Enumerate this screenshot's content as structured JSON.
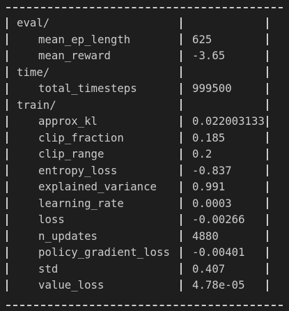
{
  "sections": [
    {
      "header": "eval/",
      "rows": [
        {
          "key": "mean_ep_length",
          "value": "625"
        },
        {
          "key": "mean_reward",
          "value": "-3.65"
        }
      ]
    },
    {
      "header": "time/",
      "rows": [
        {
          "key": "total_timesteps",
          "value": "999500"
        }
      ]
    },
    {
      "header": "train/",
      "rows": [
        {
          "key": "approx_kl",
          "value": "0.022003133"
        },
        {
          "key": "clip_fraction",
          "value": "0.185"
        },
        {
          "key": "clip_range",
          "value": "0.2"
        },
        {
          "key": "entropy_loss",
          "value": "-0.837"
        },
        {
          "key": "explained_variance",
          "value": "0.991"
        },
        {
          "key": "learning_rate",
          "value": "0.0003"
        },
        {
          "key": "loss",
          "value": "-0.00266"
        },
        {
          "key": "n_updates",
          "value": "4880"
        },
        {
          "key": "policy_gradient_loss",
          "value": "-0.00401"
        },
        {
          "key": "std",
          "value": "0.407"
        },
        {
          "key": "value_loss",
          "value": "4.78e-05"
        }
      ]
    }
  ]
}
